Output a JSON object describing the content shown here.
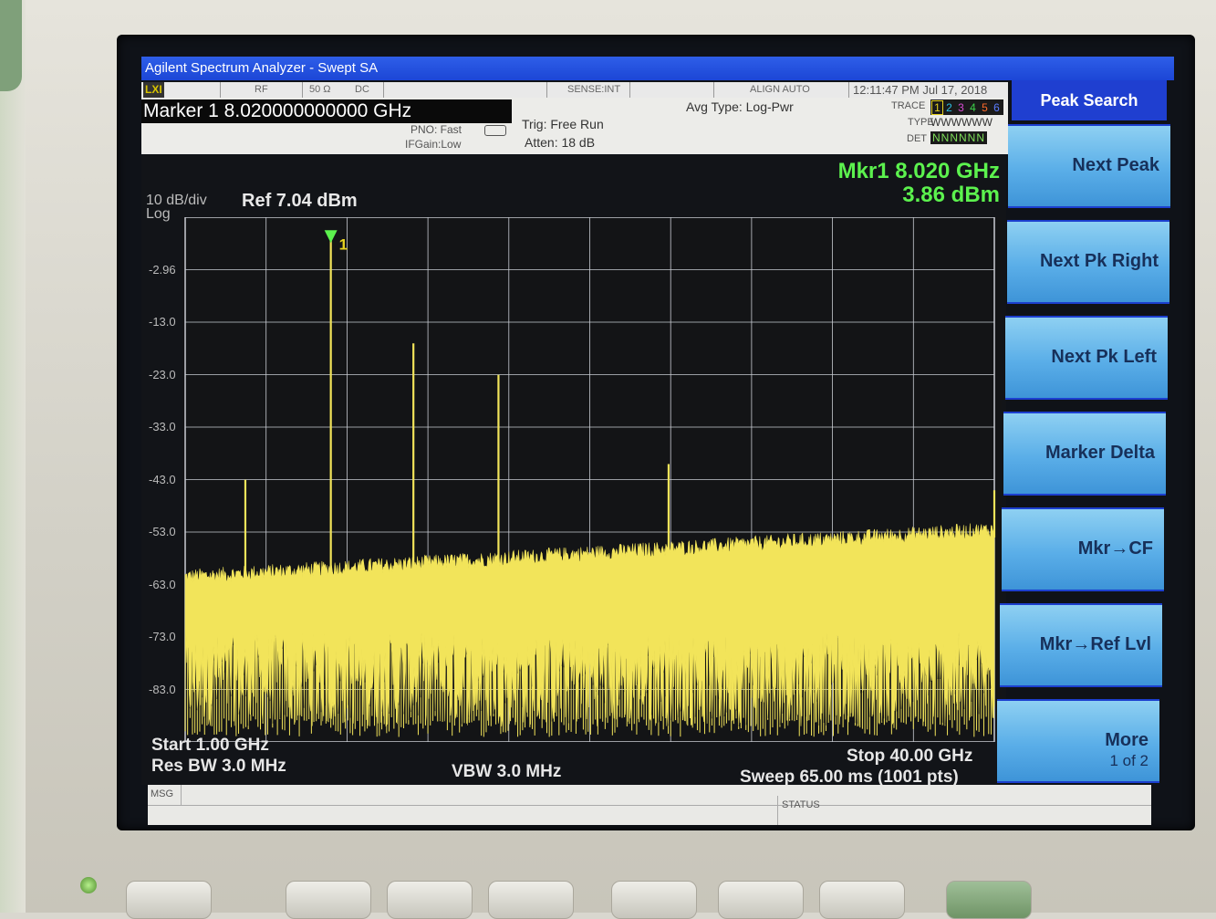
{
  "window": {
    "title": "Agilent Spectrum Analyzer - Swept SA"
  },
  "sensebar": {
    "logo": "LXI",
    "rf": "RF",
    "impedance": "50 Ω",
    "coupling": "DC",
    "sense": "SENSE:INT",
    "align": "ALIGN AUTO",
    "timestamp": "12:11:47 PM Jul 17, 2018"
  },
  "infobar": {
    "marker_freq": "Marker 1  8.020000000000 GHz",
    "pno": "PNO: Fast",
    "ifgain": "IFGain:Low",
    "trig": "Trig: Free Run",
    "atten": "Atten: 18 dB",
    "avg_type": "Avg Type: Log-Pwr",
    "trace_label": "TRACE",
    "type_label": "TYPE",
    "det_label": "DET",
    "trace_numbers": [
      "1",
      "2",
      "3",
      "4",
      "5",
      "6"
    ],
    "trace_colors": [
      "#e8d320",
      "#2ec1e6",
      "#d94bd4",
      "#3dd34a",
      "#ff6a2a",
      "#5a7cff"
    ],
    "type_value": "WWWWWW",
    "det_value": "NNNNNN"
  },
  "plot": {
    "marker_readout_freq": "Mkr1  8.020 GHz",
    "marker_readout_amp": "3.86 dBm",
    "scale": "10 dB/div",
    "scale_type": "Log",
    "ref_level": "Ref 7.04 dBm",
    "marker_label": "1",
    "start": "Start 1.00 GHz",
    "res_bw": "Res BW  3.0 MHz",
    "vbw": "VBW  3.0 MHz",
    "stop": "Stop 40.00 GHz",
    "sweep": "Sweep  65.00 ms (1001 pts)",
    "trace_color": "#f2e45a",
    "marker_color": "#5cf24e"
  },
  "chart_data": {
    "type": "line",
    "x_unit": "GHz",
    "y_unit": "dBm",
    "xlim": [
      1.0,
      40.0
    ],
    "ylim": [
      -92.96,
      7.04
    ],
    "y_ticks": [
      "-2.96",
      "-13.0",
      "-23.0",
      "-33.0",
      "-43.0",
      "-53.0",
      "-63.0",
      "-73.0",
      "-83.0"
    ],
    "y_tick_values": [
      -2.96,
      -12.96,
      -22.96,
      -32.96,
      -42.96,
      -52.96,
      -62.96,
      -72.96,
      -82.96
    ],
    "noise_floor_start_dbm": -63,
    "noise_floor_end_dbm": -54,
    "noise_min_dbm": -90,
    "peaks": [
      {
        "x": 3.9,
        "y": -43
      },
      {
        "x": 8.02,
        "y": 3.86
      },
      {
        "x": 12.0,
        "y": -17
      },
      {
        "x": 16.1,
        "y": -23
      },
      {
        "x": 24.3,
        "y": -40
      },
      {
        "x": 40.0,
        "y": -45
      }
    ]
  },
  "msgbar": {
    "msg": "MSG",
    "status": "STATUS"
  },
  "softkeys": {
    "title": "Peak Search",
    "items": [
      {
        "label": "Next Peak"
      },
      {
        "label": "Next Pk Right"
      },
      {
        "label": "Next Pk Left"
      },
      {
        "label": "Marker Delta"
      },
      {
        "label": "Mkr→CF"
      },
      {
        "label": "Mkr→Ref Lvl"
      },
      {
        "label": "More",
        "sub": "1 of 2"
      }
    ]
  }
}
